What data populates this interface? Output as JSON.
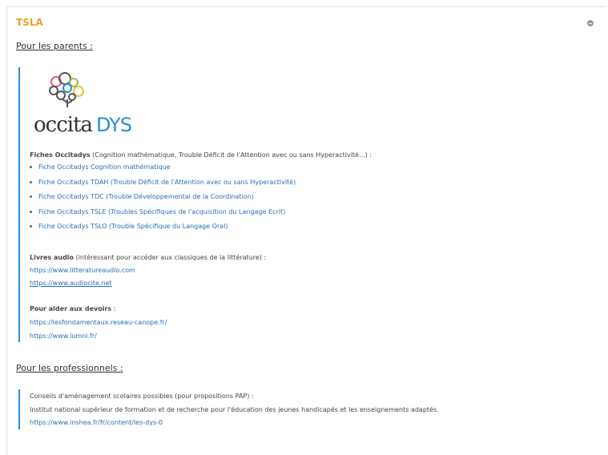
{
  "panel": {
    "title": "TSLA",
    "collapse_icon": "minus-circle-icon",
    "accent_color": "#e6a229",
    "link_color": "#2a6db5",
    "bar_color": "#2a8dd6"
  },
  "parents": {
    "heading": "Pour les parents :",
    "logo_text": "occitaDYS",
    "fiches_intro_bold": "Fiches Occitadys",
    "fiches_intro_rest": " (Cognition mathématique, Trouble Déficit de l'Attention avec ou sans Hyperactivité...) :",
    "fiches": [
      "Fiche Occitadys Cognition mathématique",
      "Fiche Occitadys TDAH (Trouble Déficit de l'Attention avec ou sans Hyperactivité)",
      "Fiche Occitadys TDC (Trouble Développemental de la Coordination)",
      "Fiche Occitadys TSLE (Troubles Spécifiques de l'acquisition du Langage Ecrit)",
      "Fiche Occitadys TSLO (Trouble Spécifique du Langage Oral)"
    ],
    "audio_bold": "Livres audio",
    "audio_rest": " (intéressant pour accéder aux classiques de la littérature) :",
    "audio_links": [
      "https://www.litteratureaudio.com",
      "https://www.audiocite.net"
    ],
    "devoirs_bold": "Pour aider aux devoirs",
    "devoirs_rest": " :",
    "devoirs_links": [
      "https://lesfondamentaux.reseau-canope.fr/",
      "https://www.lumni.fr/"
    ]
  },
  "pros": {
    "heading": "Pour les professionnels :",
    "line1": "Conseils d'aménagement scolaires possibles (pour propositions PAP) :",
    "line2": "Institut national supérieur de formation et de recherche pour l'éducation des jeunes handicapés et les enseignements adaptés.",
    "link": "https://www.inshea.fr/fr/content/les-dys-0"
  }
}
